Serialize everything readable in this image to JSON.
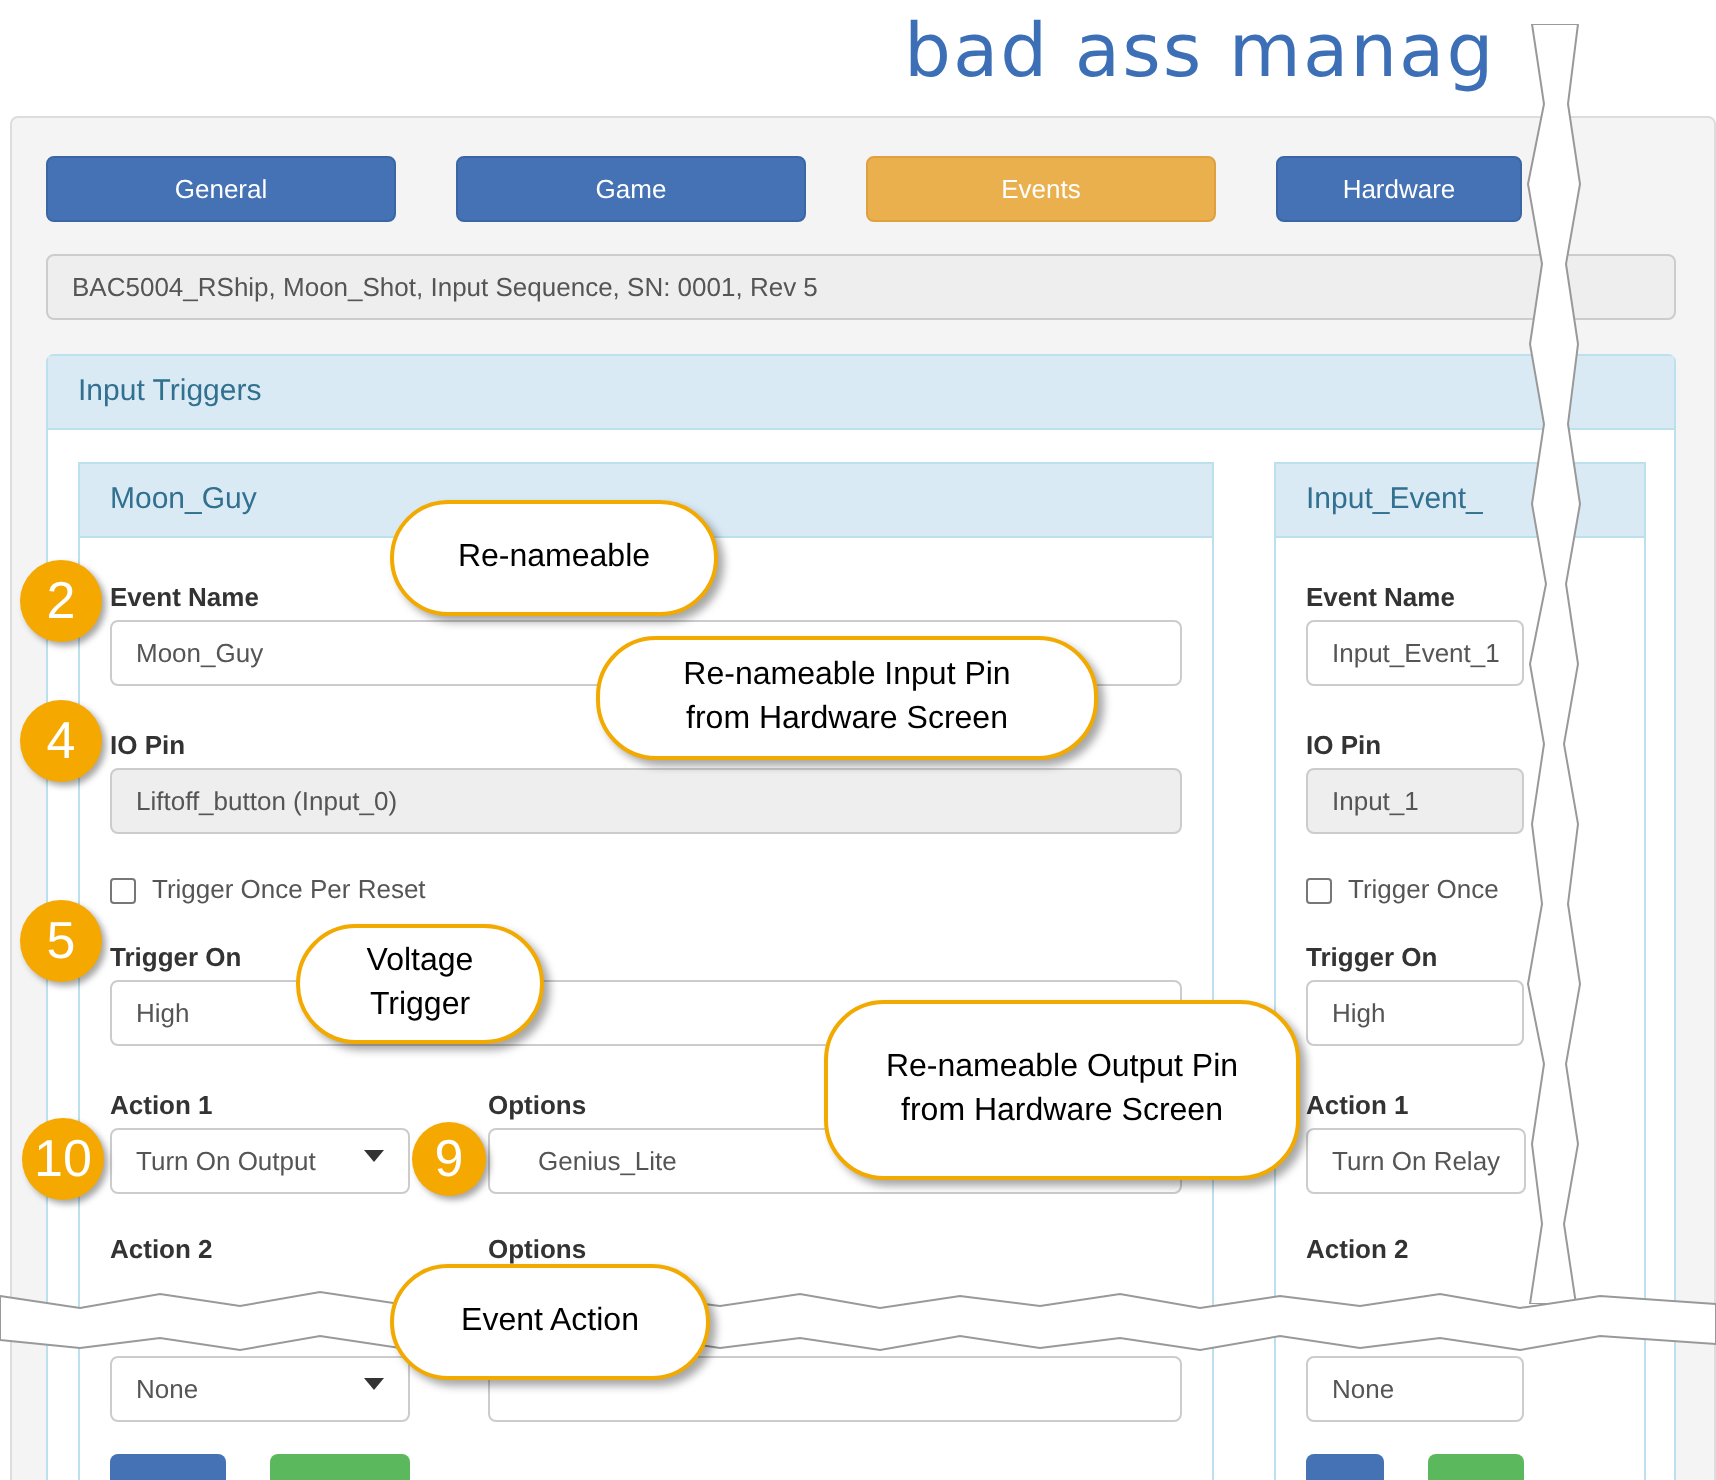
{
  "logo": "bad ass manag",
  "tabs": [
    {
      "label": "General",
      "selected": false
    },
    {
      "label": "Game",
      "selected": false
    },
    {
      "label": "Events",
      "selected": true
    },
    {
      "label": "Hardware",
      "selected": false
    }
  ],
  "info_bar": "BAC5004_RShip, Moon_Shot, Input Sequence, SN: 0001, Rev 5",
  "panel_title": "Input Triggers",
  "cards": [
    {
      "title": "Moon_Guy",
      "items": [
        {
          "kind": "input",
          "label": "Event Name",
          "value": "Moon_Guy",
          "disabled": false
        },
        {
          "kind": "input",
          "label": "IO Pin",
          "value": "Liftoff_button (Input_0)",
          "disabled": true
        },
        {
          "kind": "checkbox",
          "label": "Trigger Once Per Reset",
          "checked": false
        },
        {
          "kind": "input",
          "label": "Trigger On",
          "value": "High",
          "disabled": false
        },
        {
          "kind": "action",
          "label": "Action 1",
          "value": "Turn On Output",
          "dropdown": true,
          "options_label": "Options",
          "options_value": "Genius_Lite"
        },
        {
          "kind": "torn_action",
          "label": "Action 2",
          "value": "None",
          "dropdown": true,
          "options_label": "Options"
        }
      ],
      "buttons": [
        {
          "kind": "primary"
        },
        {
          "kind": "success"
        }
      ]
    },
    {
      "title": "Input_Event_",
      "items": [
        {
          "kind": "input",
          "label": "Event Name",
          "value": "Input_Event_1",
          "disabled": false
        },
        {
          "kind": "input",
          "label": "IO Pin",
          "value": "Input_1",
          "disabled": true
        },
        {
          "kind": "checkbox",
          "label": "Trigger Once",
          "checked": false
        },
        {
          "kind": "input",
          "label": "Trigger On",
          "value": "High",
          "disabled": false
        },
        {
          "kind": "action",
          "label": "Action 1",
          "value": "Turn On Relay",
          "dropdown": false
        },
        {
          "kind": "torn_action",
          "label": "Action 2",
          "value": "None",
          "dropdown": false
        }
      ],
      "buttons": [
        {
          "kind": "primary"
        },
        {
          "kind": "success"
        }
      ]
    }
  ],
  "callouts": [
    "Re-nameable",
    "Re-nameable Input Pin from Hardware Screen",
    "Voltage Trigger",
    "Re-nameable Output Pin from Hardware Screen",
    "Event Action"
  ],
  "badges": [
    "2",
    "4",
    "5",
    "10",
    "9"
  ]
}
